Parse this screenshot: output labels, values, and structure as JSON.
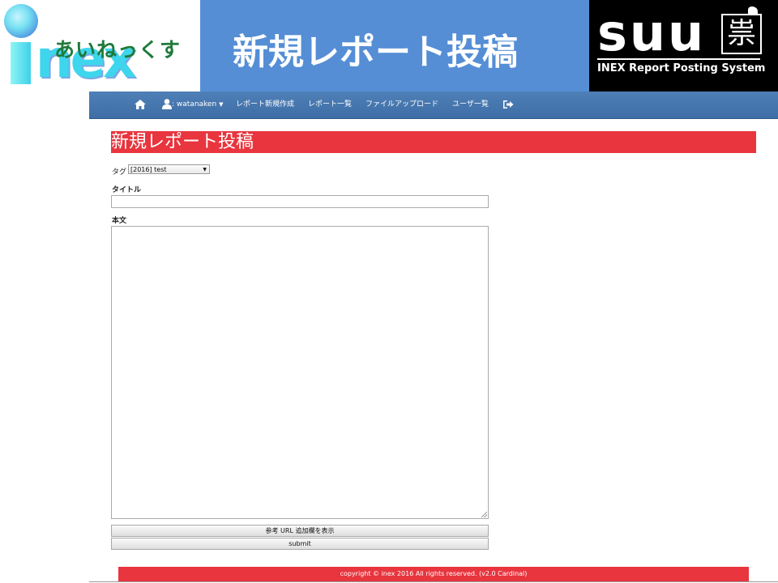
{
  "banner": {
    "logo_text": "inex",
    "logo_jp": "あいねっくす",
    "page_title": "新規レポート投稿",
    "brand": {
      "name": "SUU",
      "kanji": "祟",
      "subtitle": "INEX Report Posting System"
    }
  },
  "nav": {
    "home_icon": "home-icon",
    "user": {
      "prefix": ": ",
      "name": "watanaken"
    },
    "items": [
      {
        "label": "レポート新規作成"
      },
      {
        "label": "レポート一覧"
      },
      {
        "label": "ファイルアップロード"
      },
      {
        "label": "ユーザ一覧"
      }
    ],
    "logout_icon": "logout-icon"
  },
  "main": {
    "heading": "新規レポート投稿",
    "tag_label": "タグ",
    "tag_selected": "[2016] test",
    "title_label": "タイトル",
    "title_value": "",
    "body_label": "本文",
    "body_value": "",
    "show_ref_button": "参考 URL 追加欄を表示",
    "submit_button": "submit"
  },
  "footer": {
    "text": "copyright © inex 2016 All rights reserved. (v2.0 Cardinal)"
  },
  "colors": {
    "banner_blue": "#558ed5",
    "nav_blue": "#4577b0",
    "accent_red": "#e8353e"
  }
}
